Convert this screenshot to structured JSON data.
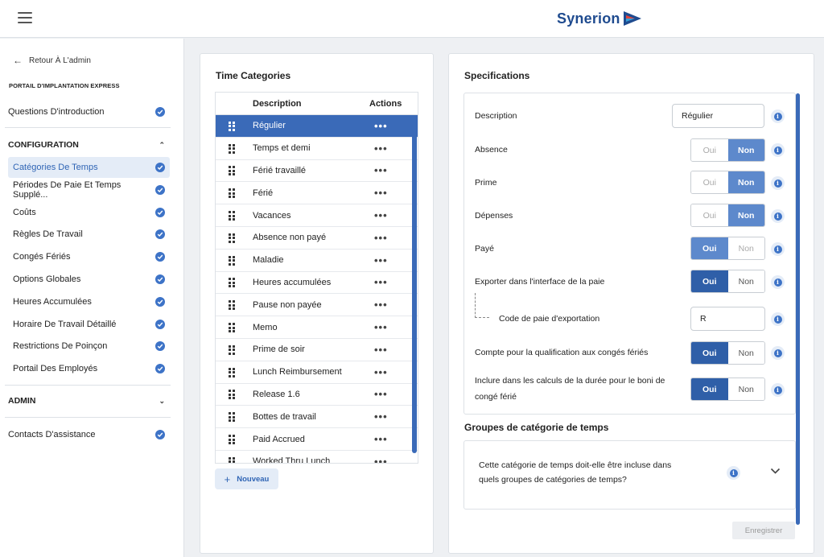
{
  "header": {
    "logo_text": "Synerion"
  },
  "sidebar": {
    "back_label": "Retour À L'admin",
    "portal_title": "PORTAIL D'IMPLANTATION EXPRESS",
    "intro_label": "Questions D'introduction",
    "config_section": "CONFIGURATION",
    "config_items": [
      {
        "label": "Catégories De Temps",
        "active": true
      },
      {
        "label": "Périodes De Paie Et Temps Supplé..."
      },
      {
        "label": "Coûts"
      },
      {
        "label": "Règles De Travail"
      },
      {
        "label": "Congés Fériés"
      },
      {
        "label": "Options Globales"
      },
      {
        "label": "Heures Accumulées"
      },
      {
        "label": "Horaire De Travail Détaillé"
      },
      {
        "label": "Restrictions De Poinçon"
      },
      {
        "label": "Portail Des Employés"
      }
    ],
    "admin_section": "ADMIN",
    "contacts_label": "Contacts D'assistance"
  },
  "categories": {
    "title": "Time Categories",
    "col_description": "Description",
    "col_actions": "Actions",
    "rows": [
      "Régulier",
      "Temps et demi",
      "Férié travaillé",
      "Férié",
      "Vacances",
      "Absence non payé",
      "Maladie",
      "Heures accumulées",
      "Pause non payée",
      "Memo",
      "Prime de soir",
      "Lunch Reimbursement",
      "Release 1.6",
      "Bottes de travail",
      "Paid Accrued",
      "Worked Thru Lunch"
    ],
    "selected_index": 0,
    "actions_glyph": "•••",
    "new_button": "Nouveau"
  },
  "specs": {
    "title": "Specifications",
    "description_label": "Description",
    "description_value": "Régulier",
    "absence_label": "Absence",
    "prime_label": "Prime",
    "depenses_label": "Dépenses",
    "paye_label": "Payé",
    "export_label": "Exporter dans l'interface de la paie",
    "export_code_label": "Code de paie d'exportation",
    "export_code_value": "R",
    "holiday_qual_label": "Compte pour la qualification aux congés fériés",
    "bonus_label_1": "Inclure dans les calculs de la durée pour le boni de",
    "bonus_label_2": "congé férié",
    "oui": "Oui",
    "non": "Non",
    "groups_title": "Groupes de catégorie de temps",
    "groups_question_1": "Cette catégorie de temps doit-elle être incluse dans",
    "groups_question_2": "quels groupes de catégories de temps?",
    "save_button": "Enregistrer"
  },
  "colors": {
    "accent": "#2f5fa8",
    "selected_row": "#3a6ab8",
    "active_nav_bg": "#e4ecf7"
  }
}
